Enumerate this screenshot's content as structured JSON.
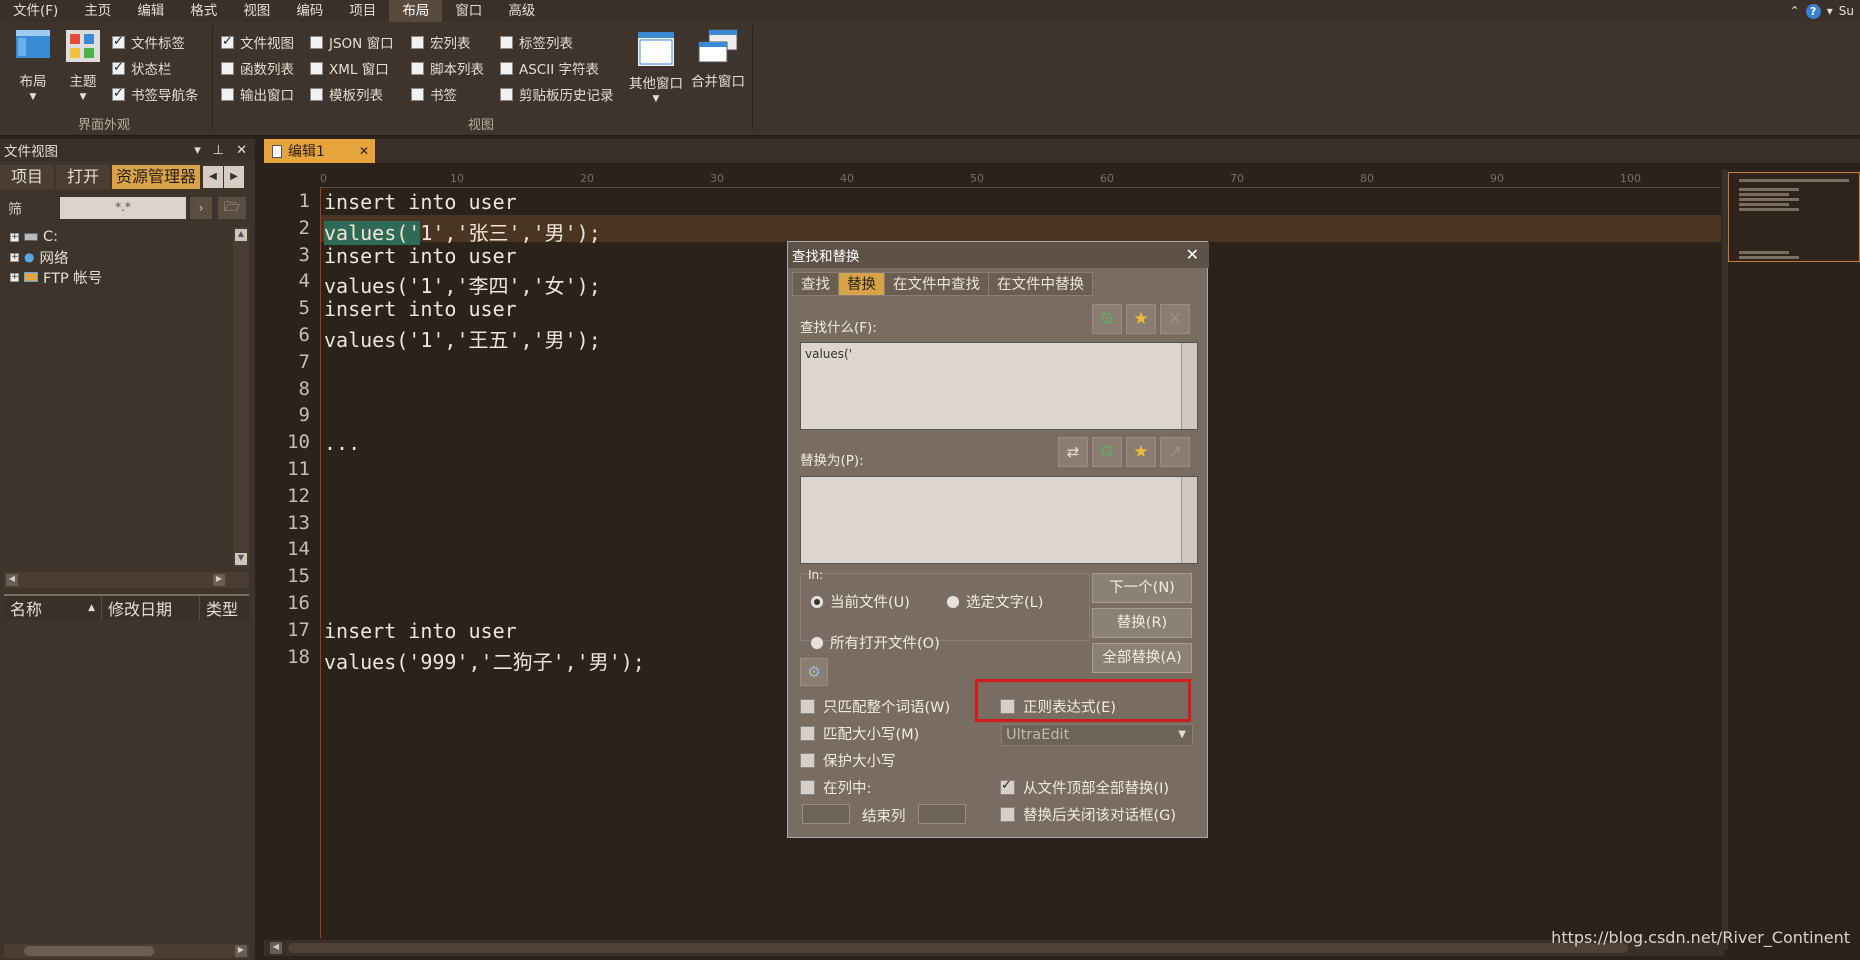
{
  "menu": {
    "items": [
      "文件(F)",
      "主页",
      "编辑",
      "格式",
      "视图",
      "编码",
      "项目",
      "布局",
      "窗口",
      "高级"
    ],
    "active_index": 7,
    "right_text": "Su"
  },
  "ribbon": {
    "layout_label": "布局",
    "theme_label": "主题",
    "group1_checks": [
      {
        "label": "文件标签",
        "checked": true
      },
      {
        "label": "状态栏",
        "checked": true
      },
      {
        "label": "书签导航条",
        "checked": true
      }
    ],
    "group1_title": "界面外观",
    "view_checks_col1": [
      {
        "label": "文件视图",
        "checked": true
      },
      {
        "label": "函数列表",
        "checked": false
      },
      {
        "label": "输出窗口",
        "checked": false
      }
    ],
    "view_checks_col2": [
      {
        "label": "JSON 窗口",
        "checked": false
      },
      {
        "label": "XML 窗口",
        "checked": false
      },
      {
        "label": "模板列表",
        "checked": false
      }
    ],
    "view_checks_col3": [
      {
        "label": "宏列表",
        "checked": false
      },
      {
        "label": "脚本列表",
        "checked": false
      },
      {
        "label": "书签",
        "checked": false
      }
    ],
    "view_checks_col4": [
      {
        "label": "标签列表",
        "checked": false
      },
      {
        "label": "ASCII 字符表",
        "checked": false
      },
      {
        "label": "剪贴板历史记录",
        "checked": false
      }
    ],
    "other_windows_label": "其他窗口",
    "merge_windows_label": "合并窗口",
    "group2_title": "视图"
  },
  "file_view": {
    "title": "文件视图",
    "tabs": [
      "项目",
      "打开",
      "资源管理器"
    ],
    "active_tab": 2,
    "filter_label": "筛",
    "filter_value": "*.*",
    "tree": [
      "C:",
      "网络",
      "FTP 帐号"
    ],
    "columns": [
      "名称",
      "修改日期",
      "类型"
    ]
  },
  "editor": {
    "tab_label": "编辑1",
    "ruler_marks": [
      "0",
      "10",
      "20",
      "30",
      "40",
      "50",
      "60",
      "70",
      "80",
      "90",
      "100"
    ],
    "lines": [
      {
        "n": "1",
        "text": "insert into user"
      },
      {
        "n": "2",
        "text": "values('1','张三','男');"
      },
      {
        "n": "3",
        "text": "insert into user"
      },
      {
        "n": "4",
        "text": "values('1','李四','女');"
      },
      {
        "n": "5",
        "text": "insert into user"
      },
      {
        "n": "6",
        "text": "values('1','王五','男');"
      },
      {
        "n": "7",
        "text": ""
      },
      {
        "n": "8",
        "text": ""
      },
      {
        "n": "9",
        "text": ""
      },
      {
        "n": "10",
        "text": "..."
      },
      {
        "n": "11",
        "text": ""
      },
      {
        "n": "12",
        "text": ""
      },
      {
        "n": "13",
        "text": ""
      },
      {
        "n": "14",
        "text": ""
      },
      {
        "n": "15",
        "text": ""
      },
      {
        "n": "16",
        "text": ""
      },
      {
        "n": "17",
        "text": "insert into user"
      },
      {
        "n": "18",
        "text": "values('999','二狗子','男');"
      }
    ],
    "selected_text": "values('",
    "line2_rest": "1','张三','男');"
  },
  "dialog": {
    "title": "查找和替换",
    "tabs": [
      "查找",
      "替换",
      "在文件中查找",
      "在文件中替换"
    ],
    "active_tab": 1,
    "find_label": "查找什么(F):",
    "find_value": "values('",
    "replace_label": "替换为(P):",
    "replace_value": "",
    "in_label": "In:",
    "scope_options": [
      {
        "label": "当前文件(U)",
        "checked": true
      },
      {
        "label": "选定文字(L)",
        "checked": false
      },
      {
        "label": "所有打开文件(O)",
        "checked": false
      }
    ],
    "buttons": [
      "下一个(N)",
      "替换(R)",
      "全部替换(A)"
    ],
    "options_left": [
      {
        "label": "只匹配整个词语(W)",
        "checked": false
      },
      {
        "label": "匹配大小写(M)",
        "checked": false
      },
      {
        "label": "保护大小写",
        "checked": false
      },
      {
        "label": "在列中:",
        "checked": false
      }
    ],
    "end_col_label": "结束列",
    "regex": {
      "label": "正则表达式(E)",
      "checked": false
    },
    "regex_engine": "UltraEdit",
    "options_right": [
      {
        "label": "从文件顶部全部替换(I)",
        "checked": true
      },
      {
        "label": "替换后关闭该对话框(G)",
        "checked": false
      }
    ]
  },
  "watermark": "https://blog.csdn.net/River_Continent",
  "colors": {
    "accent": "#e8a43c",
    "highlight_box": "#d01c1c",
    "selection": "#2e6a55"
  }
}
